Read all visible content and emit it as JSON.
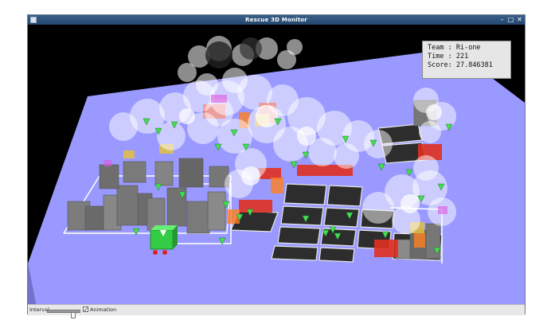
{
  "window": {
    "title": "Rescue 3D Monitor",
    "controls": {
      "minimize": "–",
      "maximize": "□",
      "close": "✕"
    }
  },
  "info": {
    "team_label": "Team",
    "team_value": "Ri-one",
    "time_label": "Time",
    "time_value": "221",
    "score_label": "Score",
    "score_value": "27.846381"
  },
  "controls": {
    "interval_label": "Interval",
    "interval_value": 0.2,
    "animation_label": "Animation",
    "animation_checked": true,
    "check_mark": "✓"
  },
  "colors": {
    "ground": "#9999ff",
    "road": "#2d2d2d",
    "building": "#777777",
    "fire": "#e03020",
    "smoke": "#ffffff",
    "agent_marker": "#44dd55",
    "title_bar": "#2c5580"
  },
  "icons": {
    "app": "app-icon",
    "agent": "green-triangle-marker",
    "fire_truck": "green-cube"
  }
}
